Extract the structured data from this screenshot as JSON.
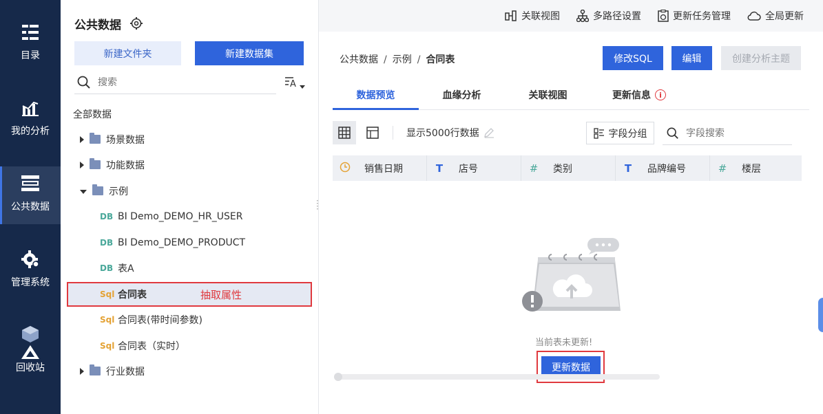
{
  "nav": {
    "items": [
      {
        "label": "目录",
        "icon": "catalog-icon"
      },
      {
        "label": "我的分析",
        "icon": "chart-icon"
      },
      {
        "label": "公共数据",
        "icon": "database-icon"
      },
      {
        "label": "管理系统",
        "icon": "gear-icon"
      },
      {
        "label": "回收站",
        "icon": "recycle-icon"
      }
    ],
    "active": "公共数据"
  },
  "tree": {
    "title": "公共数据",
    "new_folder": "新建文件夹",
    "new_dataset": "新建数据集",
    "search_placeholder": "搜索",
    "root": "全部数据",
    "items": [
      {
        "label": "场景数据",
        "type": "folder"
      },
      {
        "label": "功能数据",
        "type": "folder"
      },
      {
        "label": "示例",
        "type": "folder-open"
      },
      {
        "label": "BI Demo_DEMO_HR_USER",
        "type": "DB"
      },
      {
        "label": "BI Demo_DEMO_PRODUCT",
        "type": "DB"
      },
      {
        "label": "表A",
        "type": "DB"
      },
      {
        "label": "合同表",
        "type": "SQL"
      },
      {
        "label": "合同表(带时间参数)",
        "type": "SQL"
      },
      {
        "label": "合同表（实时）",
        "type": "SQL"
      },
      {
        "label": "行业数据",
        "type": "folder"
      }
    ],
    "tag_db": "DB",
    "tag_sql": "Sql",
    "annotation": "抽取属性"
  },
  "topbar": {
    "related_view": "关联视图",
    "multipath": "多路径设置",
    "update_tasks": "更新任务管理",
    "global_update": "全局更新"
  },
  "breadcrumb": {
    "a": "公共数据",
    "b": "示例",
    "c": "合同表",
    "sep": "/"
  },
  "actions": {
    "edit_sql": "修改SQL",
    "edit": "编辑",
    "create_topic": "创建分析主题"
  },
  "tabs": [
    "数据预览",
    "血缘分析",
    "关联视图",
    "更新信息"
  ],
  "toolbar": {
    "show_rows": "显示5000行数据",
    "field_group": "字段分组",
    "field_search_placeholder": "字段搜索"
  },
  "columns": [
    {
      "label": "销售日期",
      "type": "date"
    },
    {
      "label": "店号",
      "type": "text"
    },
    {
      "label": "类别",
      "type": "number"
    },
    {
      "label": "品牌编号",
      "type": "text"
    },
    {
      "label": "楼层",
      "type": "number"
    }
  ],
  "empty": {
    "message": "当前表未更新!",
    "update_button": "更新数据"
  },
  "colors": {
    "nav_bg": "#16294a",
    "primary": "#2f64dc",
    "highlight": "#e0393e"
  }
}
